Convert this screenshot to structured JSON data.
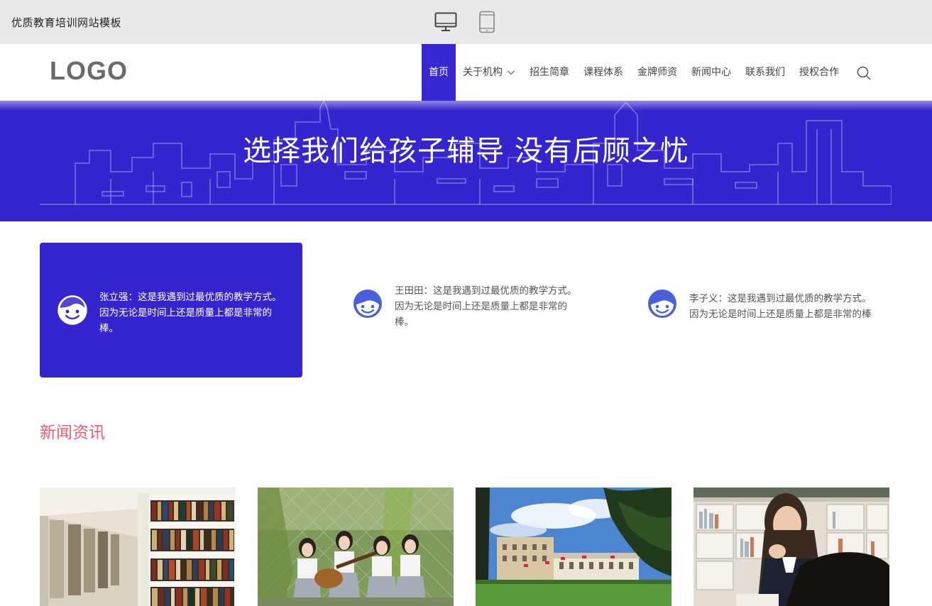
{
  "preview_bar": {
    "title": "优质教育培训网站模板",
    "devices": [
      "desktop-icon",
      "tablet-icon"
    ]
  },
  "header": {
    "logo": "LOGO",
    "nav": [
      {
        "label": "首页",
        "active": true
      },
      {
        "label": "关于机构",
        "has_dropdown": true
      },
      {
        "label": "招生简章"
      },
      {
        "label": "课程体系"
      },
      {
        "label": "金牌师资"
      },
      {
        "label": "新闻中心"
      },
      {
        "label": "联系我们"
      },
      {
        "label": "授权合作"
      }
    ],
    "search_icon": "search-icon"
  },
  "banner": {
    "title": "选择我们给孩子辅导 没有后顾之忧"
  },
  "testimonials": [
    {
      "text": "张立强：这是我遇到过最优质的教学方式。因为无论是时间上还是质量上都是非常的棒。",
      "active": true
    },
    {
      "text": "王田田：这是我遇到过最优质的教学方式。因为无论是时间上还是质量上都是非常的棒。",
      "active": false
    },
    {
      "text": "李子义：这是我遇到过最优质的教学方式。因为无论是时间上还是质量上都是非常的棒",
      "active": false
    }
  ],
  "news": {
    "title": "新闻资讯",
    "images": [
      "library-photo",
      "students-guitar-photo",
      "palace-photo",
      "student-thinking-photo"
    ]
  },
  "colors": {
    "primary": "#3525cf",
    "accent": "#f05b72",
    "preview_bar": "#e9e9e9"
  }
}
